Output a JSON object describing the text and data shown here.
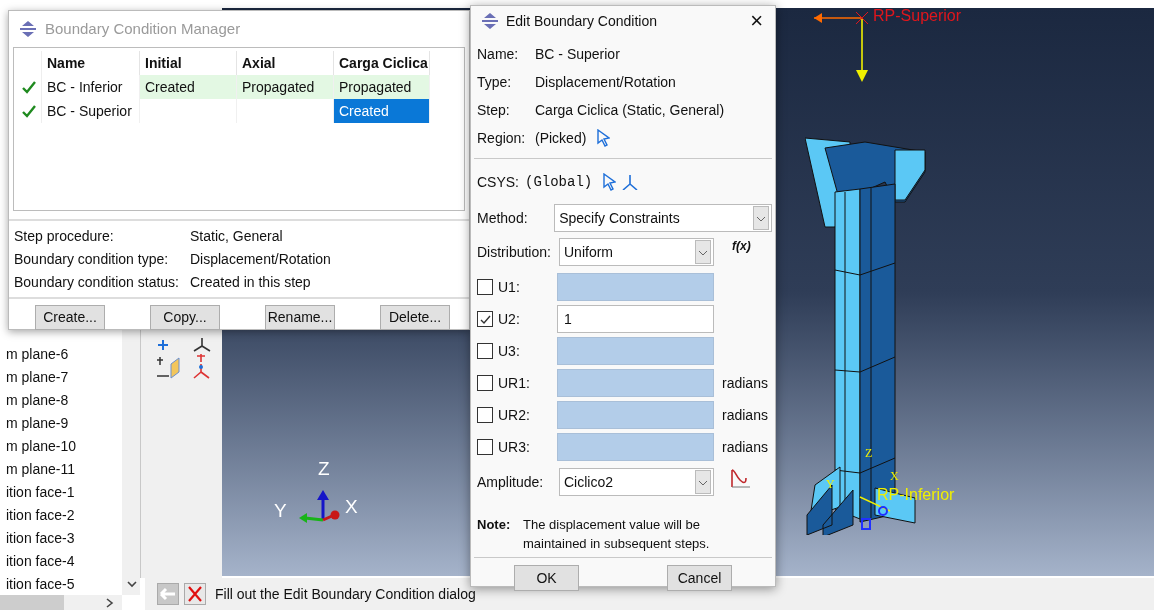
{
  "model_tree": {
    "items": [
      "m plane-6",
      "m plane-7",
      "m plane-8",
      "m plane-9",
      "m plane-10",
      "m plane-11",
      "ition face-1",
      "ition face-2",
      "ition face-3",
      "ition face-4",
      "ition face-5"
    ]
  },
  "viewport": {
    "reference_points": [
      {
        "label": "RP-Superior",
        "color": "#e0161c"
      },
      {
        "label": "RP-Inferior",
        "color": "#f0f000"
      }
    ],
    "view_triad": {
      "z": "Z",
      "y": "Y",
      "x": "X"
    },
    "local_triad": {
      "z": "Z",
      "x": "X",
      "y": "Y"
    }
  },
  "prompt": {
    "text": "Fill out the Edit Boundary Condition dialog"
  },
  "bc_manager": {
    "title": "Boundary Condition Manager",
    "columns": [
      "Name",
      "Initial",
      "Axial",
      "Carga Ciclica"
    ],
    "rows": [
      {
        "active": true,
        "cells": [
          {
            "text": "BC - Inferior",
            "selected": false
          },
          {
            "text": "Created",
            "selected": false
          },
          {
            "text": "Propagated",
            "selected": false
          },
          {
            "text": "Propagated",
            "selected": false
          }
        ]
      },
      {
        "active": true,
        "cells": [
          {
            "text": "BC - Superior",
            "selected": false
          },
          {
            "selected": false
          },
          {
            "selected": false
          },
          {
            "text": "Created",
            "selected": true
          }
        ]
      }
    ],
    "details": [
      {
        "label": "Step procedure:",
        "value": "Static, General"
      },
      {
        "label": "Boundary condition type:",
        "value": "Displacement/Rotation"
      },
      {
        "label": "Boundary condition status:",
        "value": "Created in this step"
      }
    ],
    "buttons": [
      "Create...",
      "Copy...",
      "Rename...",
      "Delete..."
    ]
  },
  "edit_dialog": {
    "title": "Edit Boundary Condition",
    "close": "×",
    "info": [
      {
        "label": "Name:",
        "value": "BC - Superior"
      },
      {
        "label": "Type:",
        "value": "Displacement/Rotation"
      },
      {
        "label": "Step:",
        "value": "Carga Ciclica (Static, General)"
      },
      {
        "label": "Region:",
        "value": "(Picked)"
      }
    ],
    "csys": {
      "label": "CSYS:",
      "value": "(Global)"
    },
    "method": {
      "label": "Method:",
      "value": "Specify Constraints"
    },
    "distribution": {
      "label": "Distribution:",
      "value": "Uniform",
      "function": "f(x)"
    },
    "components": [
      {
        "label": "U1:",
        "checked": false
      },
      {
        "label": "U2:",
        "checked": true,
        "value": "1"
      },
      {
        "label": "U3:",
        "checked": false
      },
      {
        "label": "UR1:",
        "checked": false,
        "unit": "radians"
      },
      {
        "label": "UR2:",
        "checked": false,
        "unit": "radians"
      },
      {
        "label": "UR3:",
        "checked": false,
        "unit": "radians"
      }
    ],
    "amplitude": {
      "label": "Amplitude:",
      "value": "Ciclico2"
    },
    "note": {
      "label": "Note:",
      "text": "The displacement value will be maintained in subsequent steps."
    },
    "buttons": [
      "OK",
      "Cancel"
    ]
  }
}
